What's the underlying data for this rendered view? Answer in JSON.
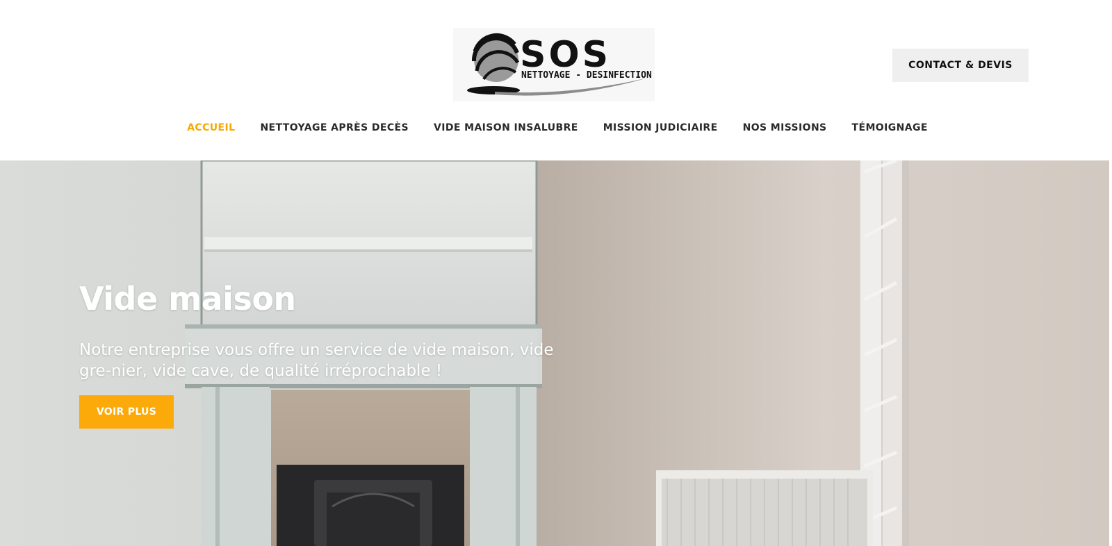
{
  "header": {
    "logo": {
      "name": "SOS",
      "tagline": "NETTOYAGE - DESINFECTION"
    },
    "contact_button": "CONTACT & DEVIS"
  },
  "nav": {
    "items": [
      {
        "label": "ACCUEIL",
        "active": true
      },
      {
        "label": "NETTOYAGE APRÈS DECÈS",
        "active": false
      },
      {
        "label": "VIDE MAISON INSALUBRE",
        "active": false
      },
      {
        "label": "MISSION JUDICIAIRE",
        "active": false
      },
      {
        "label": "NOS MISSIONS",
        "active": false
      },
      {
        "label": "TÉMOIGNAGE",
        "active": false
      }
    ]
  },
  "hero": {
    "title": "Vide maison",
    "text": "Notre entreprise vous offre un service de vide maison, vide gre-nier, vide cave, de qualité irréprochable !",
    "button": "VOIR PLUS",
    "slides": 3
  },
  "colors": {
    "accent": "#f5a800",
    "button": "#fcaa0a",
    "text_dark": "#2a2a2a"
  }
}
